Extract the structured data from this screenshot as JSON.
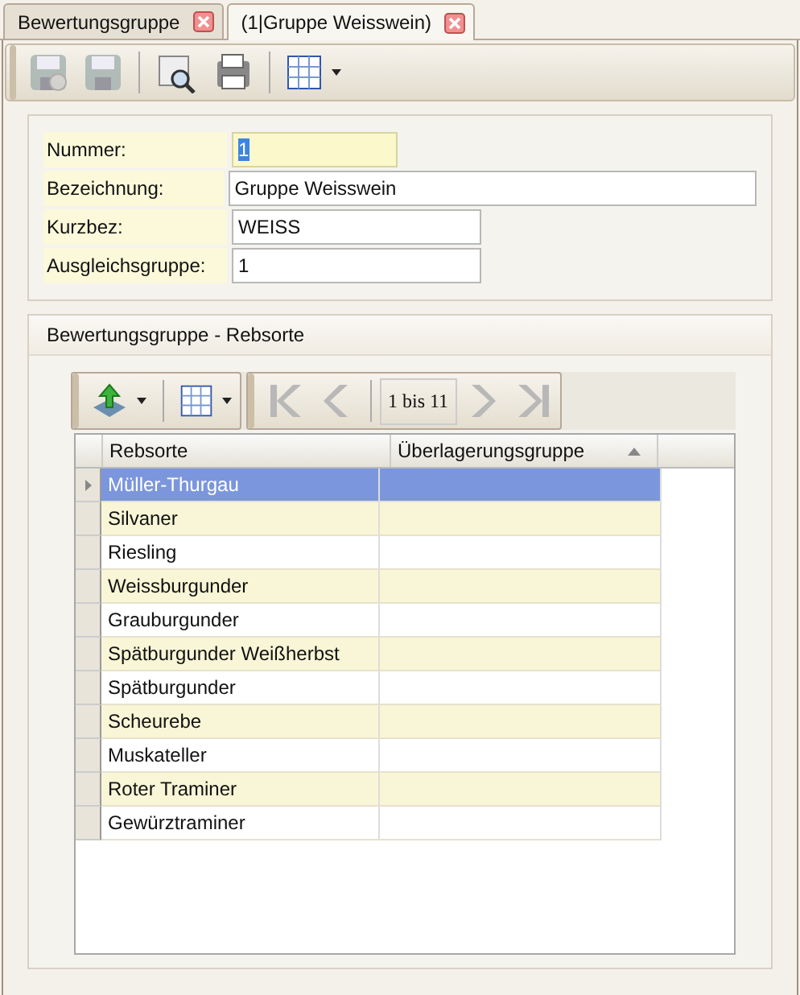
{
  "tabs": [
    {
      "label": "Bewertungsgruppe",
      "selected": false
    },
    {
      "label": "(1|Gruppe Weisswein)",
      "selected": true
    }
  ],
  "toolbar": [
    {
      "kind": "save-check",
      "disabled": true
    },
    {
      "kind": "save",
      "disabled": true
    },
    {
      "kind": "sep"
    },
    {
      "kind": "preview",
      "disabled": false
    },
    {
      "kind": "print",
      "disabled": false
    },
    {
      "kind": "sep"
    },
    {
      "kind": "grid",
      "disabled": false
    }
  ],
  "form": [
    {
      "label": "Nummer:",
      "value": "1",
      "focused": true
    },
    {
      "label": "Bezeichnung:",
      "value": "Gruppe Weisswein",
      "focused": false
    },
    {
      "label": "Kurzbez:",
      "value": "WEISS",
      "focused": false
    },
    {
      "label": "Ausgleichsgruppe:",
      "value": "1",
      "focused": false
    }
  ],
  "detail": {
    "title": "Bewertungsgruppe - Rebsorte",
    "pager": {
      "reading": "1 bis 11"
    },
    "columns": [
      {
        "label": "Rebsorte",
        "sorted": false
      },
      {
        "label": "Überlagerungsgruppe",
        "sorted": true
      }
    ],
    "rows": [
      {
        "rebsorte": "Müller-Thurgau",
        "selected": true
      },
      {
        "rebsorte": "Silvaner",
        "selected": false
      },
      {
        "rebsorte": "Riesling",
        "selected": false
      },
      {
        "rebsorte": "Weissburgunder",
        "selected": false
      },
      {
        "rebsorte": "Grauburgunder",
        "selected": false
      },
      {
        "rebsorte": "Spätburgunder Weißherbst",
        "selected": false
      },
      {
        "rebsorte": "Spätburgunder",
        "selected": false
      },
      {
        "rebsorte": "Scheurebe",
        "selected": false
      },
      {
        "rebsorte": "Muskateller",
        "selected": false
      },
      {
        "rebsorte": "Roter Traminer",
        "selected": false
      },
      {
        "rebsorte": "Gewürztraminer",
        "selected": false
      }
    ]
  }
}
